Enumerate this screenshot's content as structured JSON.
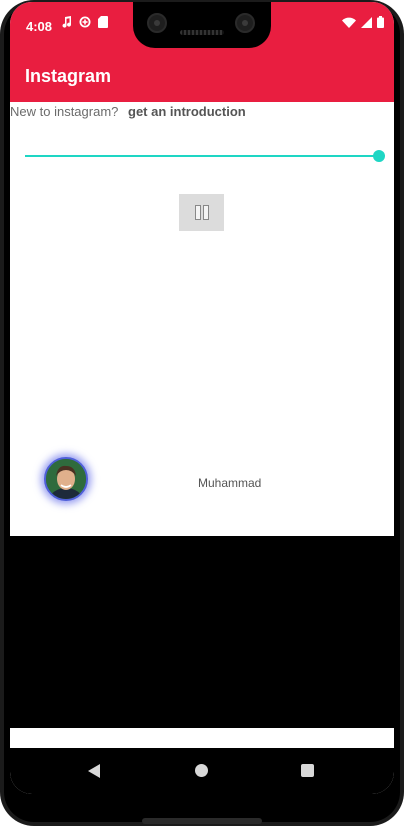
{
  "status_bar": {
    "time": "4:08",
    "left_icons": [
      "music-note-icon",
      "data-saver-icon",
      "sd-card-icon"
    ],
    "right_icons": [
      "wifi-icon",
      "signal-icon",
      "battery-icon"
    ]
  },
  "app_bar": {
    "title": "Instagram"
  },
  "intro": {
    "question": "New to instagram?",
    "link_label": "get an introduction"
  },
  "player": {
    "progress": 1.0,
    "state": "playing",
    "control_icon": "pause-icon"
  },
  "profile": {
    "username": "Muhammad"
  },
  "nav_bar": {
    "items": [
      "back",
      "home",
      "recents"
    ]
  },
  "colors": {
    "app_bar": "#e91e40",
    "accent": "#1ed6c4",
    "avatar_ring": "#4f5fd9"
  }
}
